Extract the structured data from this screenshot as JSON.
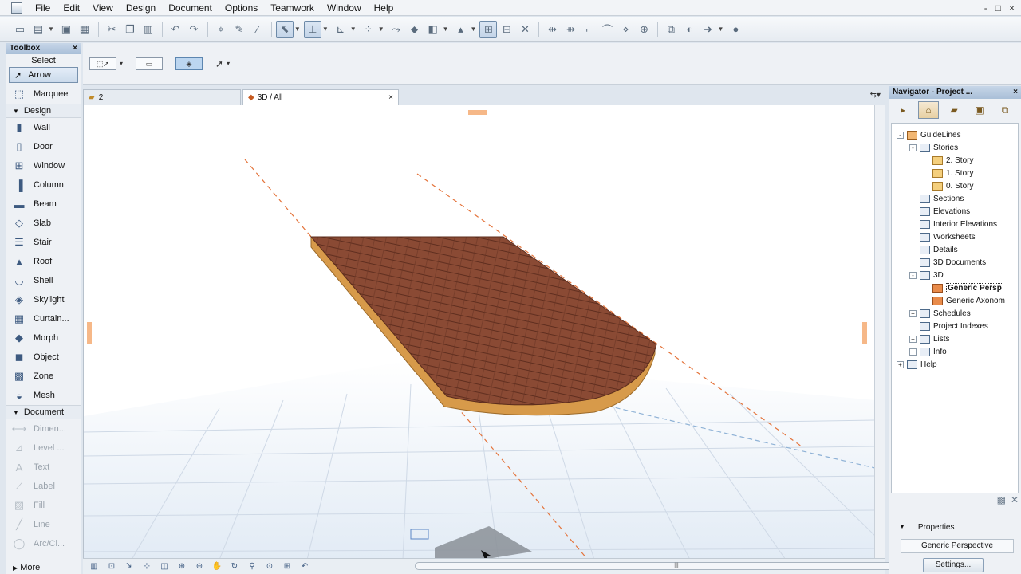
{
  "menu": [
    "File",
    "Edit",
    "View",
    "Design",
    "Document",
    "Options",
    "Teamwork",
    "Window",
    "Help"
  ],
  "window_controls": [
    "-",
    "□",
    "×"
  ],
  "toolbox": {
    "title": "Toolbox",
    "select_label": "Select",
    "arrow_label": "Arrow",
    "marquee_label": "Marquee",
    "design_group": "Design",
    "design_tools": [
      {
        "label": "Wall",
        "icon": "wall-icon"
      },
      {
        "label": "Door",
        "icon": "door-icon"
      },
      {
        "label": "Window",
        "icon": "window-icon"
      },
      {
        "label": "Column",
        "icon": "column-icon"
      },
      {
        "label": "Beam",
        "icon": "beam-icon"
      },
      {
        "label": "Slab",
        "icon": "slab-icon"
      },
      {
        "label": "Stair",
        "icon": "stair-icon"
      },
      {
        "label": "Roof",
        "icon": "roof-icon"
      },
      {
        "label": "Shell",
        "icon": "shell-icon"
      },
      {
        "label": "Skylight",
        "icon": "skylight-icon"
      },
      {
        "label": "Curtain...",
        "icon": "curtain-wall-icon"
      },
      {
        "label": "Morph",
        "icon": "morph-icon"
      },
      {
        "label": "Object",
        "icon": "object-icon"
      },
      {
        "label": "Zone",
        "icon": "zone-icon"
      },
      {
        "label": "Mesh",
        "icon": "mesh-icon"
      }
    ],
    "document_group": "Document",
    "document_tools": [
      {
        "label": "Dimen...",
        "icon": "dimension-icon"
      },
      {
        "label": "Level ...",
        "icon": "level-icon"
      },
      {
        "label": "Text",
        "icon": "text-icon"
      },
      {
        "label": "Label",
        "icon": "label-icon"
      },
      {
        "label": "Fill",
        "icon": "fill-icon"
      },
      {
        "label": "Line",
        "icon": "line-icon"
      },
      {
        "label": "Arc/Ci...",
        "icon": "arc-icon"
      }
    ],
    "more_label": "More"
  },
  "tabs": {
    "story_tab": "2",
    "view_tab": "3D / All",
    "close": "×"
  },
  "navigator": {
    "title": "Navigator - Project ...",
    "tree": [
      {
        "label": "GuideLines",
        "level": 0,
        "toggle": "-",
        "icon": "house"
      },
      {
        "label": "Stories",
        "level": 1,
        "toggle": "-",
        "icon": "box"
      },
      {
        "label": "2. Story",
        "level": 2,
        "toggle": "",
        "icon": "folder"
      },
      {
        "label": "1. Story",
        "level": 2,
        "toggle": "",
        "icon": "folder"
      },
      {
        "label": "0. Story",
        "level": 2,
        "toggle": "",
        "icon": "folder"
      },
      {
        "label": "Sections",
        "level": 1,
        "toggle": "",
        "icon": "box"
      },
      {
        "label": "Elevations",
        "level": 1,
        "toggle": "",
        "icon": "box"
      },
      {
        "label": "Interior Elevations",
        "level": 1,
        "toggle": "",
        "icon": "box"
      },
      {
        "label": "Worksheets",
        "level": 1,
        "toggle": "",
        "icon": "box"
      },
      {
        "label": "Details",
        "level": 1,
        "toggle": "",
        "icon": "box"
      },
      {
        "label": "3D Documents",
        "level": 1,
        "toggle": "",
        "icon": "box"
      },
      {
        "label": "3D",
        "level": 1,
        "toggle": "-",
        "icon": "box"
      },
      {
        "label": "Generic Persp",
        "level": 2,
        "toggle": "",
        "icon": "cam",
        "selected": true
      },
      {
        "label": "Generic Axonom",
        "level": 2,
        "toggle": "",
        "icon": "cam"
      },
      {
        "label": "Schedules",
        "level": 1,
        "toggle": "+",
        "icon": "box"
      },
      {
        "label": "Project Indexes",
        "level": 1,
        "toggle": "",
        "icon": "box"
      },
      {
        "label": "Lists",
        "level": 1,
        "toggle": "+",
        "icon": "box"
      },
      {
        "label": "Info",
        "level": 1,
        "toggle": "+",
        "icon": "box"
      },
      {
        "label": "Help",
        "level": 0,
        "toggle": "+",
        "icon": "box"
      }
    ],
    "properties_label": "Properties",
    "properties_value": "Generic Perspective",
    "settings_label": "Settings..."
  },
  "colors": {
    "slab_top": "#8a4a34",
    "slab_edge": "#d79a4a",
    "guide_line": "#e4733a",
    "grid_line": "#cdd8e6"
  }
}
